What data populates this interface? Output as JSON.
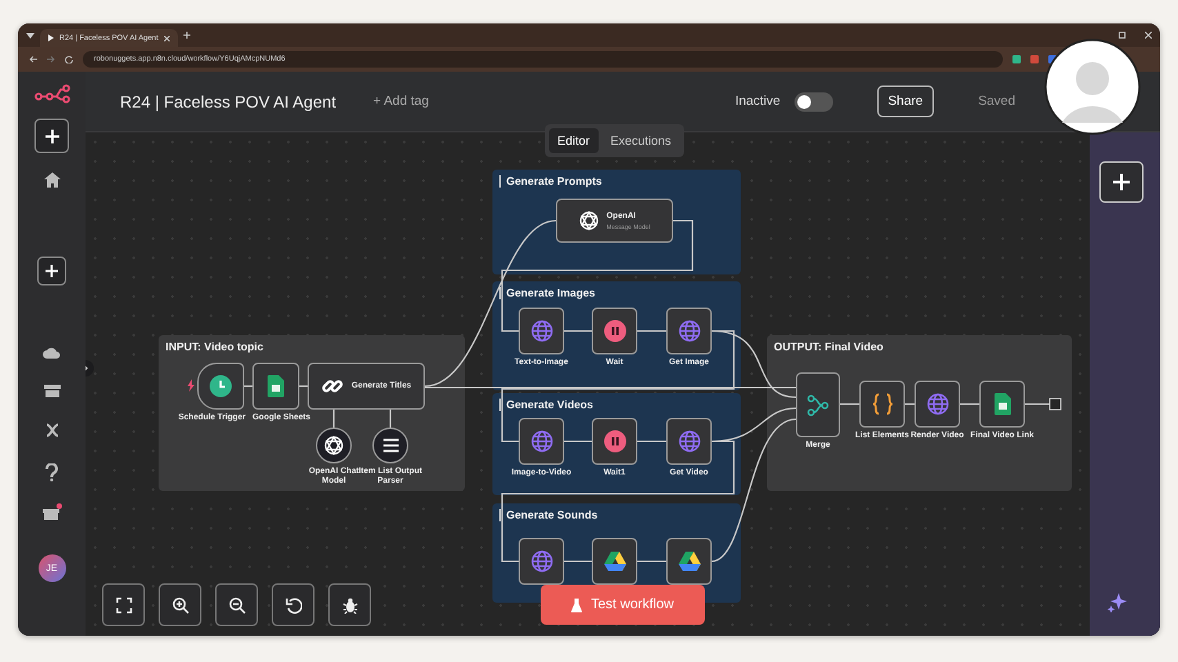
{
  "browser": {
    "tab_title": "R24 | Faceless POV AI Agent",
    "url": "robonuggets.app.n8n.cloud/workflow/Y6UqjAMcpNUMd6"
  },
  "header": {
    "title": "R24 | Faceless POV AI Agent",
    "add_tag": "+ Add tag",
    "status_label": "Inactive",
    "active": false,
    "share": "Share",
    "saved": "Saved"
  },
  "view_tabs": [
    {
      "label": "Editor",
      "selected": true
    },
    {
      "label": "Executions",
      "selected": false
    }
  ],
  "sidebar": {
    "avatar_initials": "JE"
  },
  "sections": [
    {
      "title": "INPUT: Video topic",
      "color": "#3b3b3c",
      "nodes": [
        {
          "kind": "trigger",
          "label": "Schedule Trigger"
        },
        {
          "kind": "sheets",
          "label": "Google Sheets"
        },
        {
          "kind": "chain",
          "label": "Generate Titles"
        },
        {
          "kind": "chat-model",
          "label": "OpenAI Chat Model"
        },
        {
          "kind": "parser",
          "label": "Item List Output Parser"
        }
      ]
    },
    {
      "title": "Generate Prompts",
      "color": "#1d3550",
      "nodes": [
        {
          "kind": "openai",
          "label": "OpenAI",
          "subtitle": "Message Model"
        }
      ]
    },
    {
      "title": "Generate Images",
      "color": "#1d3550",
      "nodes": [
        {
          "kind": "http",
          "label": "Text-to-Image"
        },
        {
          "kind": "wait",
          "label": "Wait"
        },
        {
          "kind": "http",
          "label": "Get Image"
        }
      ]
    },
    {
      "title": "Generate Videos",
      "color": "#1d3550",
      "nodes": [
        {
          "kind": "http",
          "label": "Image-to-Video"
        },
        {
          "kind": "wait",
          "label": "Wait1"
        },
        {
          "kind": "http",
          "label": "Get Video"
        }
      ]
    },
    {
      "title": "Generate Sounds",
      "color": "#1d3550",
      "nodes": [
        {
          "kind": "http"
        },
        {
          "kind": "drive"
        },
        {
          "kind": "drive"
        }
      ]
    },
    {
      "title": "OUTPUT: Final Video",
      "color": "#3b3b3c",
      "nodes": [
        {
          "kind": "merge",
          "label": "Merge"
        },
        {
          "kind": "code",
          "label": "List Elements"
        },
        {
          "kind": "http",
          "label": "Render Video"
        },
        {
          "kind": "sheets",
          "label": "Final Video Link"
        }
      ]
    }
  ],
  "test_button": "Test workflow"
}
